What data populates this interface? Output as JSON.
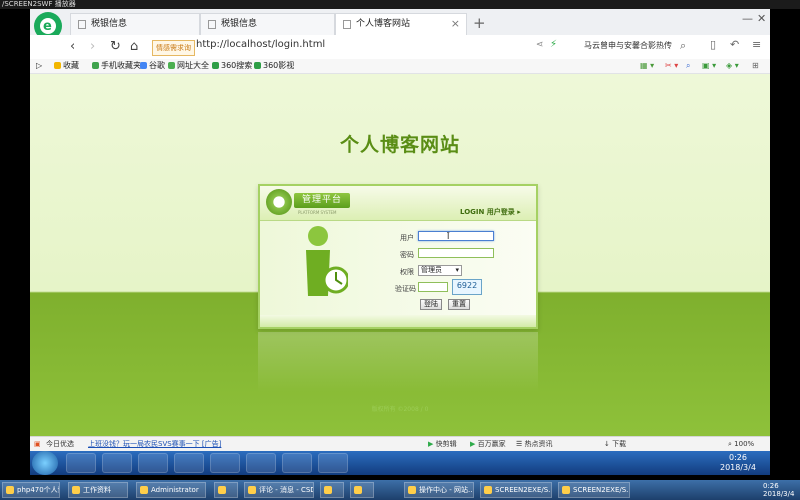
{
  "player": {
    "title": "/SCREEN2SWF 播放器"
  },
  "browser": {
    "tabs": [
      {
        "label": "税银信息"
      },
      {
        "label": "税银信息"
      },
      {
        "label": "个人博客网站"
      }
    ],
    "tag_pill": "情感需求询",
    "url": "http://localhost/login.html",
    "hot_text": "马云曾申与安馨合影热传",
    "bookmarks": [
      "收藏",
      "手机收藏夹",
      "谷歌",
      "网址大全",
      "360搜索",
      "360影视"
    ],
    "status": {
      "left": "今日优选",
      "news": "上班没钱？玩一局农民SVS赛事一下 [广告]",
      "items": [
        "快剪辑",
        "百万赢家",
        "热点资讯",
        "下载",
        "100%"
      ]
    }
  },
  "page": {
    "site_title": "个人博客网站",
    "panel": {
      "brand": "管理平台",
      "brand_sub": "PLATFORM SYSTEM",
      "login_label": "LOGIN 用户登录 ▸",
      "user_label": "用户",
      "password_label": "密码",
      "role_label": "权限",
      "role_value": "管理员",
      "captcha_label": "验证码",
      "captcha_code": "6922",
      "login_button": "登陆",
      "reset_button": "重置"
    },
    "copyright": "版权所有 ©2008 / 0"
  },
  "taskbar": {
    "clock_time": "0:26",
    "clock_date": "2018/3/4",
    "items": [
      {
        "label": "php470个人博客..."
      },
      {
        "label": "工作资料"
      },
      {
        "label": "Administrator"
      },
      {
        "label": ""
      },
      {
        "label": "评论 - 消息 - CSDN..."
      },
      {
        "label": ""
      },
      {
        "label": ""
      },
      {
        "label": "操作中心 - 网站..."
      },
      {
        "label": "SCREEN2EXE/S..."
      },
      {
        "label": "SCREEN2EXE/S..."
      }
    ],
    "clock2_time": "0:26",
    "clock2_date": "2018/3/4"
  },
  "colors": {
    "accent_green": "#5a8d15",
    "panel_border": "#a5d163"
  }
}
